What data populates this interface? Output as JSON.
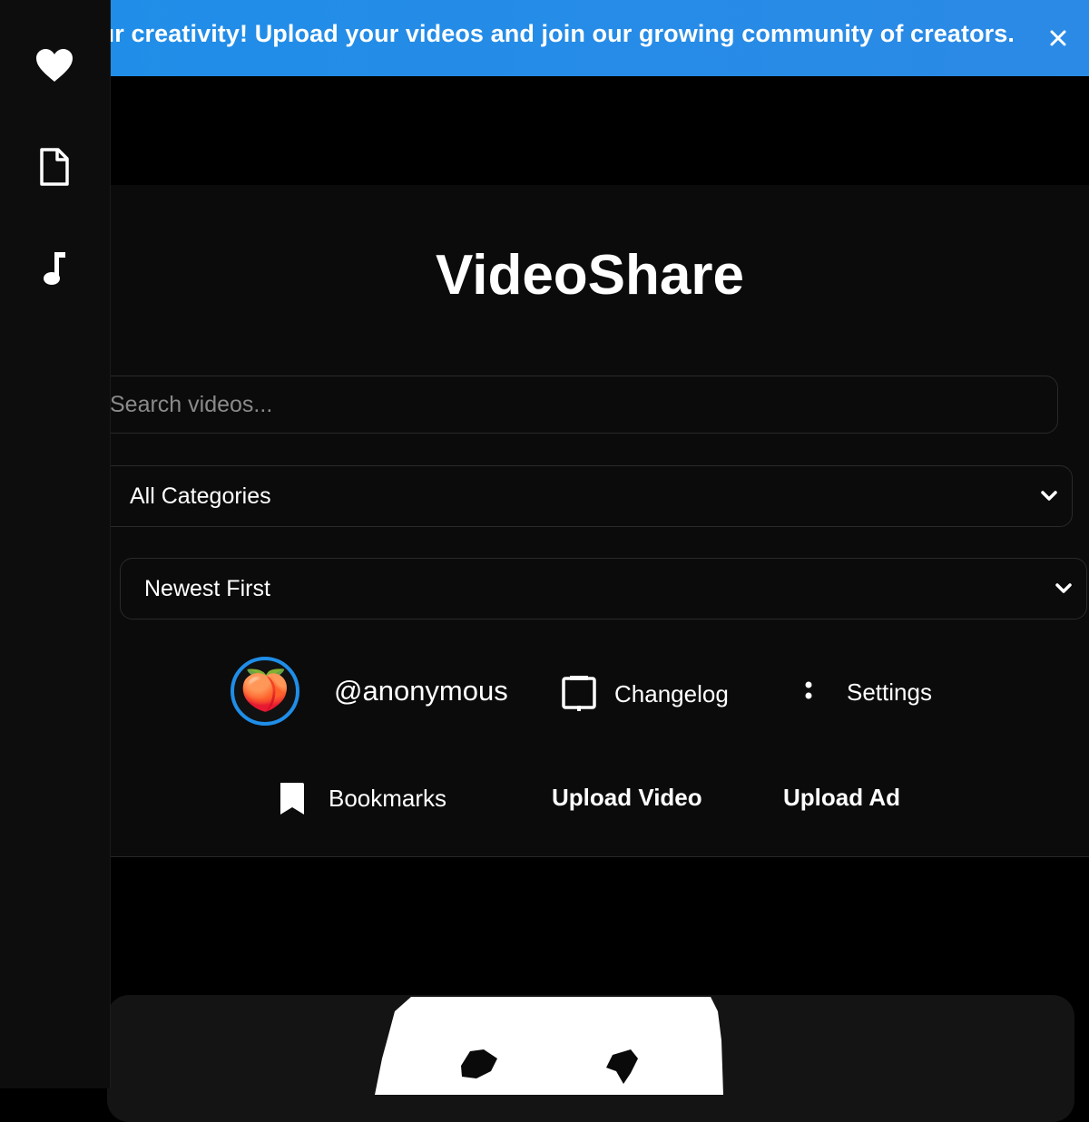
{
  "banner": {
    "text": "Showcase your creativity! Upload your videos and join our growing community of creators.",
    "close_symbol": "✕",
    "background": "#1f8ee8"
  },
  "sidebar": {
    "items": [
      {
        "icon": "heart-icon"
      },
      {
        "icon": "document-icon"
      },
      {
        "icon": "music-note-icon"
      }
    ]
  },
  "app": {
    "title": "VideoShare"
  },
  "search": {
    "placeholder": "Search videos...",
    "value": ""
  },
  "filters": {
    "category": {
      "selected": "All Categories"
    },
    "sort": {
      "selected": "Newest First"
    }
  },
  "nav": {
    "profile": {
      "username": "@anonymous",
      "avatar_emoji": "🍑",
      "ring_color": "#1f8ee8"
    },
    "changelog": {
      "label": "Changelog",
      "icon": "tablet-icon"
    },
    "settings": {
      "label": "Settings",
      "icon": "more-vertical-icon"
    },
    "bookmarks": {
      "label": "Bookmarks",
      "icon": "bookmark-icon"
    },
    "upload_video": {
      "label": "Upload Video"
    },
    "upload_ad": {
      "label": "Upload Ad"
    }
  },
  "feed": {
    "first_video": {
      "thumbnail": "ghost-pixel-art"
    }
  }
}
